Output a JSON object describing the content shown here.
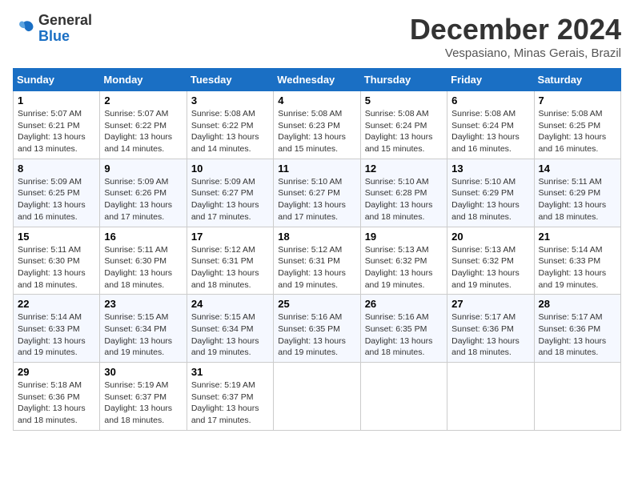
{
  "header": {
    "logo": {
      "general": "General",
      "blue": "Blue"
    },
    "title": "December 2024",
    "location": "Vespasiano, Minas Gerais, Brazil"
  },
  "weekdays": [
    "Sunday",
    "Monday",
    "Tuesday",
    "Wednesday",
    "Thursday",
    "Friday",
    "Saturday"
  ],
  "weeks": [
    [
      {
        "day": "1",
        "sunrise": "5:07 AM",
        "sunset": "6:21 PM",
        "daylight": "13 hours and 13 minutes."
      },
      {
        "day": "2",
        "sunrise": "5:07 AM",
        "sunset": "6:22 PM",
        "daylight": "13 hours and 14 minutes."
      },
      {
        "day": "3",
        "sunrise": "5:08 AM",
        "sunset": "6:22 PM",
        "daylight": "13 hours and 14 minutes."
      },
      {
        "day": "4",
        "sunrise": "5:08 AM",
        "sunset": "6:23 PM",
        "daylight": "13 hours and 15 minutes."
      },
      {
        "day": "5",
        "sunrise": "5:08 AM",
        "sunset": "6:24 PM",
        "daylight": "13 hours and 15 minutes."
      },
      {
        "day": "6",
        "sunrise": "5:08 AM",
        "sunset": "6:24 PM",
        "daylight": "13 hours and 16 minutes."
      },
      {
        "day": "7",
        "sunrise": "5:08 AM",
        "sunset": "6:25 PM",
        "daylight": "13 hours and 16 minutes."
      }
    ],
    [
      {
        "day": "8",
        "sunrise": "5:09 AM",
        "sunset": "6:25 PM",
        "daylight": "13 hours and 16 minutes."
      },
      {
        "day": "9",
        "sunrise": "5:09 AM",
        "sunset": "6:26 PM",
        "daylight": "13 hours and 17 minutes."
      },
      {
        "day": "10",
        "sunrise": "5:09 AM",
        "sunset": "6:27 PM",
        "daylight": "13 hours and 17 minutes."
      },
      {
        "day": "11",
        "sunrise": "5:10 AM",
        "sunset": "6:27 PM",
        "daylight": "13 hours and 17 minutes."
      },
      {
        "day": "12",
        "sunrise": "5:10 AM",
        "sunset": "6:28 PM",
        "daylight": "13 hours and 18 minutes."
      },
      {
        "day": "13",
        "sunrise": "5:10 AM",
        "sunset": "6:29 PM",
        "daylight": "13 hours and 18 minutes."
      },
      {
        "day": "14",
        "sunrise": "5:11 AM",
        "sunset": "6:29 PM",
        "daylight": "13 hours and 18 minutes."
      }
    ],
    [
      {
        "day": "15",
        "sunrise": "5:11 AM",
        "sunset": "6:30 PM",
        "daylight": "13 hours and 18 minutes."
      },
      {
        "day": "16",
        "sunrise": "5:11 AM",
        "sunset": "6:30 PM",
        "daylight": "13 hours and 18 minutes."
      },
      {
        "day": "17",
        "sunrise": "5:12 AM",
        "sunset": "6:31 PM",
        "daylight": "13 hours and 18 minutes."
      },
      {
        "day": "18",
        "sunrise": "5:12 AM",
        "sunset": "6:31 PM",
        "daylight": "13 hours and 19 minutes."
      },
      {
        "day": "19",
        "sunrise": "5:13 AM",
        "sunset": "6:32 PM",
        "daylight": "13 hours and 19 minutes."
      },
      {
        "day": "20",
        "sunrise": "5:13 AM",
        "sunset": "6:32 PM",
        "daylight": "13 hours and 19 minutes."
      },
      {
        "day": "21",
        "sunrise": "5:14 AM",
        "sunset": "6:33 PM",
        "daylight": "13 hours and 19 minutes."
      }
    ],
    [
      {
        "day": "22",
        "sunrise": "5:14 AM",
        "sunset": "6:33 PM",
        "daylight": "13 hours and 19 minutes."
      },
      {
        "day": "23",
        "sunrise": "5:15 AM",
        "sunset": "6:34 PM",
        "daylight": "13 hours and 19 minutes."
      },
      {
        "day": "24",
        "sunrise": "5:15 AM",
        "sunset": "6:34 PM",
        "daylight": "13 hours and 19 minutes."
      },
      {
        "day": "25",
        "sunrise": "5:16 AM",
        "sunset": "6:35 PM",
        "daylight": "13 hours and 19 minutes."
      },
      {
        "day": "26",
        "sunrise": "5:16 AM",
        "sunset": "6:35 PM",
        "daylight": "13 hours and 18 minutes."
      },
      {
        "day": "27",
        "sunrise": "5:17 AM",
        "sunset": "6:36 PM",
        "daylight": "13 hours and 18 minutes."
      },
      {
        "day": "28",
        "sunrise": "5:17 AM",
        "sunset": "6:36 PM",
        "daylight": "13 hours and 18 minutes."
      }
    ],
    [
      {
        "day": "29",
        "sunrise": "5:18 AM",
        "sunset": "6:36 PM",
        "daylight": "13 hours and 18 minutes."
      },
      {
        "day": "30",
        "sunrise": "5:19 AM",
        "sunset": "6:37 PM",
        "daylight": "13 hours and 18 minutes."
      },
      {
        "day": "31",
        "sunrise": "5:19 AM",
        "sunset": "6:37 PM",
        "daylight": "13 hours and 17 minutes."
      },
      null,
      null,
      null,
      null
    ]
  ]
}
